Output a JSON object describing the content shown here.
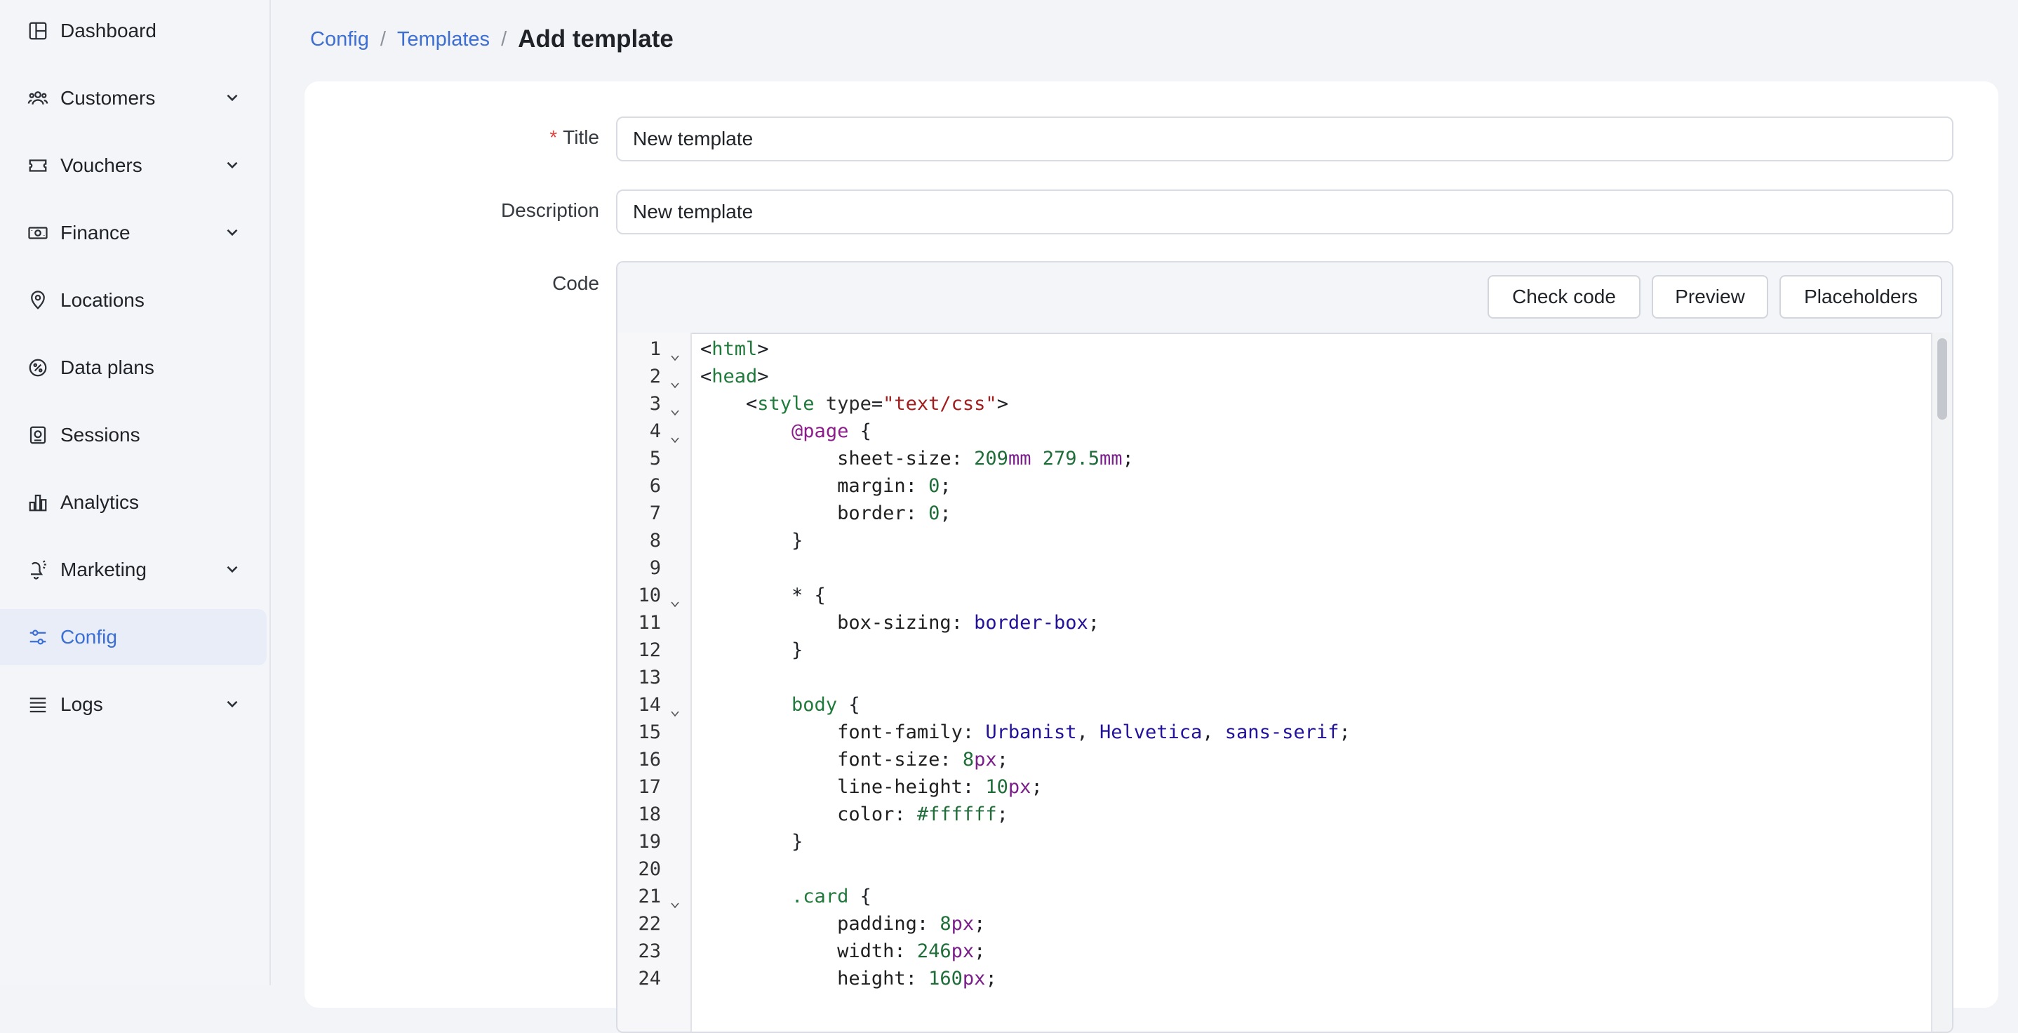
{
  "sidebar": {
    "items": [
      {
        "label": "Dashboard",
        "icon": "dashboard-icon",
        "has_chevron": false,
        "active": false
      },
      {
        "label": "Customers",
        "icon": "customers-icon",
        "has_chevron": true,
        "active": false
      },
      {
        "label": "Vouchers",
        "icon": "voucher-icon",
        "has_chevron": true,
        "active": false
      },
      {
        "label": "Finance",
        "icon": "finance-icon",
        "has_chevron": true,
        "active": false
      },
      {
        "label": "Locations",
        "icon": "location-pin-icon",
        "has_chevron": false,
        "active": false
      },
      {
        "label": "Data plans",
        "icon": "data-plans-icon",
        "has_chevron": false,
        "active": false
      },
      {
        "label": "Sessions",
        "icon": "sessions-icon",
        "has_chevron": false,
        "active": false
      },
      {
        "label": "Analytics",
        "icon": "analytics-icon",
        "has_chevron": false,
        "active": false
      },
      {
        "label": "Marketing",
        "icon": "marketing-icon",
        "has_chevron": true,
        "active": false
      },
      {
        "label": "Config",
        "icon": "config-sliders-icon",
        "has_chevron": false,
        "active": true
      },
      {
        "label": "Logs",
        "icon": "logs-icon",
        "has_chevron": true,
        "active": false
      }
    ]
  },
  "breadcrumb": {
    "items": [
      "Config",
      "Templates"
    ],
    "separator": "/",
    "current": "Add template"
  },
  "form": {
    "title_label": "Title",
    "required_mark": "*",
    "title_value": "New template",
    "description_label": "Description",
    "description_value": "New template",
    "code_label": "Code"
  },
  "editor": {
    "buttons": {
      "check_code": "Check code",
      "preview": "Preview",
      "placeholders": "Placeholders"
    },
    "lines": [
      {
        "n": "1",
        "fold": true,
        "text": "<html>"
      },
      {
        "n": "2",
        "fold": true,
        "text": "<head>"
      },
      {
        "n": "3",
        "fold": true,
        "text": "    <style type=\"text/css\">"
      },
      {
        "n": "4",
        "fold": true,
        "text": "        @page {"
      },
      {
        "n": "5",
        "fold": false,
        "text": "            sheet-size: 209mm 279.5mm;"
      },
      {
        "n": "6",
        "fold": false,
        "text": "            margin: 0;"
      },
      {
        "n": "7",
        "fold": false,
        "text": "            border: 0;"
      },
      {
        "n": "8",
        "fold": false,
        "text": "        }"
      },
      {
        "n": "9",
        "fold": false,
        "text": ""
      },
      {
        "n": "10",
        "fold": true,
        "text": "        * {"
      },
      {
        "n": "11",
        "fold": false,
        "text": "            box-sizing: border-box;"
      },
      {
        "n": "12",
        "fold": false,
        "text": "        }"
      },
      {
        "n": "13",
        "fold": false,
        "text": ""
      },
      {
        "n": "14",
        "fold": true,
        "text": "        body {"
      },
      {
        "n": "15",
        "fold": false,
        "text": "            font-family: Urbanist, Helvetica, sans-serif;"
      },
      {
        "n": "16",
        "fold": false,
        "text": "            font-size: 8px;"
      },
      {
        "n": "17",
        "fold": false,
        "text": "            line-height: 10px;"
      },
      {
        "n": "18",
        "fold": false,
        "text": "            color: #ffffff;"
      },
      {
        "n": "19",
        "fold": false,
        "text": "        }"
      },
      {
        "n": "20",
        "fold": false,
        "text": ""
      },
      {
        "n": "21",
        "fold": true,
        "text": "        .card {"
      },
      {
        "n": "22",
        "fold": false,
        "text": "            padding: 8px;"
      },
      {
        "n": "23",
        "fold": false,
        "text": "            width: 246px;"
      },
      {
        "n": "24",
        "fold": false,
        "text": "            height: 160px;"
      }
    ]
  },
  "colors": {
    "accent": "#3b6fd4",
    "active_bg": "#e8edf8",
    "required": "#e0443c",
    "sidebar_bg": "#f4f5f9",
    "page_bg": "#f3f4f7"
  }
}
